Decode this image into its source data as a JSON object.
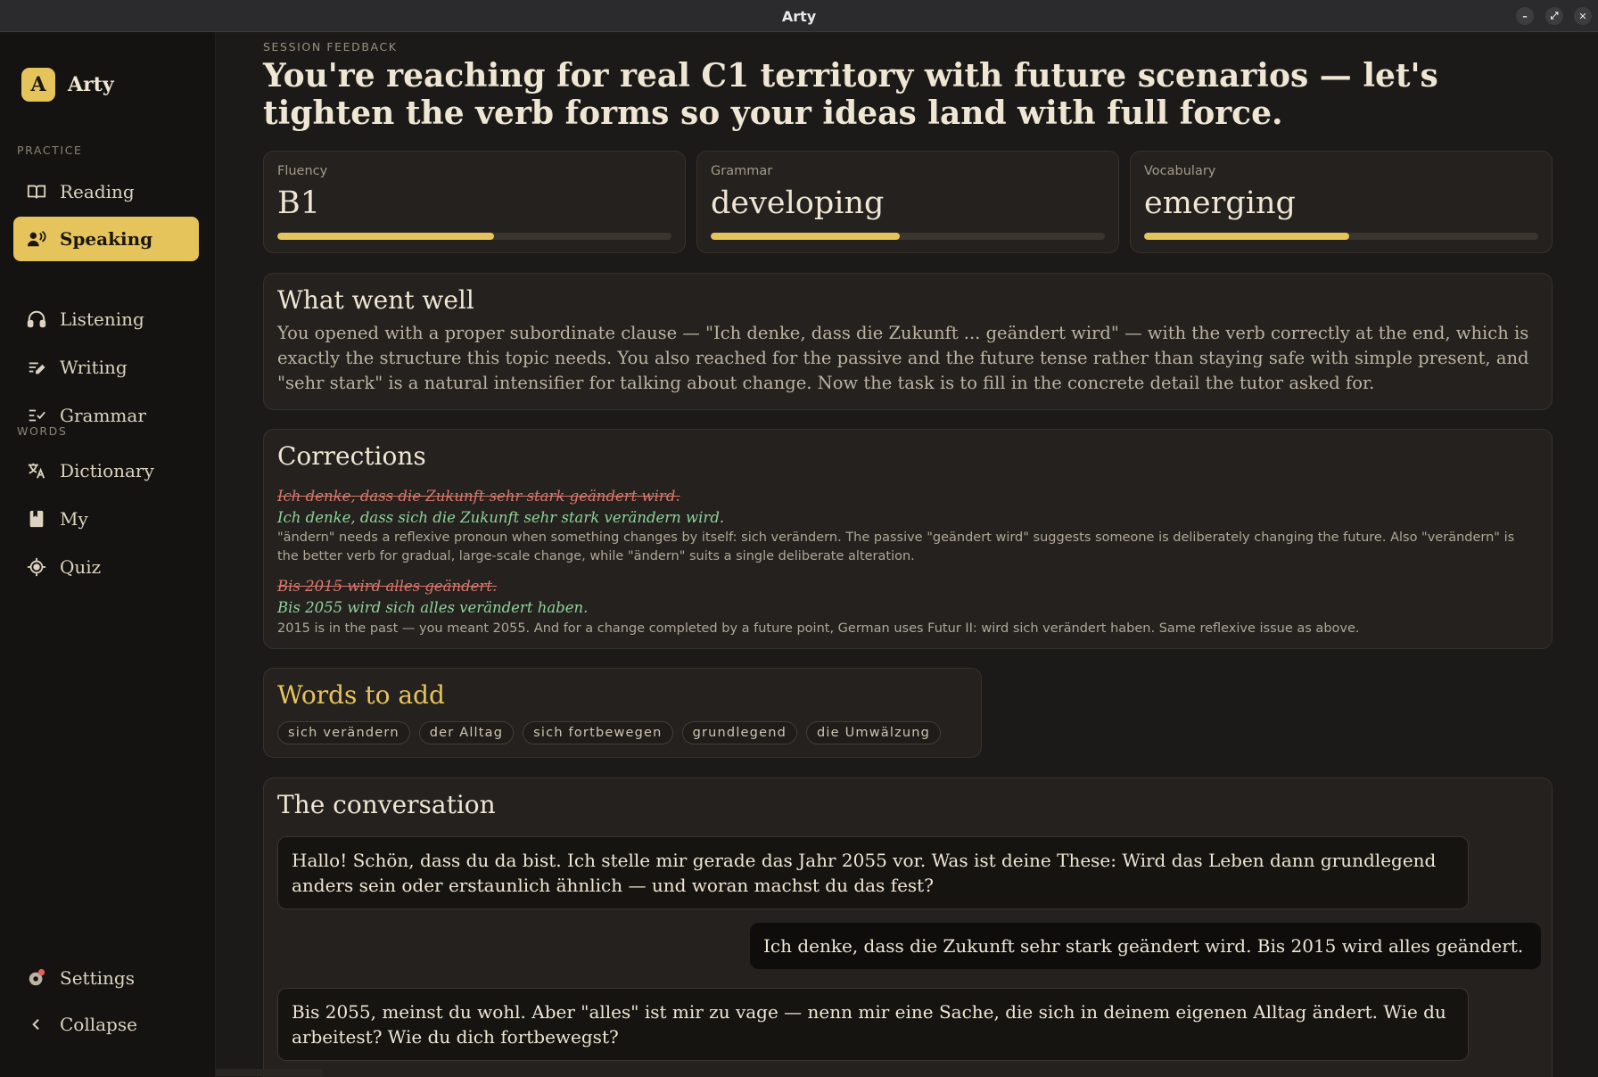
{
  "window": {
    "title": "Arty",
    "controls": {
      "minimize": "–",
      "maximize": "⤢",
      "close": "✕"
    }
  },
  "sidebar": {
    "brand_badge": "A",
    "brand_name": "Arty",
    "practice_label": "PRACTICE",
    "practice_items": [
      {
        "label": "Reading",
        "icon": "book-open-icon"
      },
      {
        "label": "Speaking",
        "icon": "speaking-person-icon",
        "active": true
      },
      {
        "label": "Listening",
        "icon": "headphones-icon"
      },
      {
        "label": "Writing",
        "icon": "pen-lines-icon"
      },
      {
        "label": "Grammar",
        "icon": "checklist-icon"
      }
    ],
    "words_label": "WORDS",
    "words_items": [
      {
        "label": "Dictionary",
        "icon": "translate-icon"
      },
      {
        "label": "My",
        "icon": "bookmark-book-icon"
      },
      {
        "label": "Quiz",
        "icon": "target-icon"
      }
    ],
    "settings_label": "Settings",
    "collapse_label": "Collapse"
  },
  "feedback": {
    "eyebrow": "SESSION FEEDBACK",
    "headline": "You're reaching for real C1 territory with future scenarios — let's tighten the verb forms so your ideas land with full force.",
    "metrics": [
      {
        "label": "Fluency",
        "value": "B1",
        "level": 0.55
      },
      {
        "label": "Grammar",
        "value": "developing",
        "level": 0.48
      },
      {
        "label": "Vocabulary",
        "value": "emerging",
        "level": 0.52
      }
    ],
    "went_well_title": "What went well",
    "went_well_text": "You opened with a proper subordinate clause — \"Ich denke, dass die Zukunft ... geändert wird\" — with the verb correctly at the end, which is exactly the structure this topic needs. You also reached for the passive and the future tense rather than staying safe with simple present, and \"sehr stark\" is a natural intensifier for talking about change. Now the task is to fill in the concrete detail the tutor asked for.",
    "corrections_title": "Corrections",
    "corrections": [
      {
        "wrong": "Ich denke, dass die Zukunft sehr stark geändert wird.",
        "right": "Ich denke, dass sich die Zukunft sehr stark verändern wird.",
        "explain": "\"ändern\" needs a reflexive pronoun when something changes by itself: sich verändern. The passive \"geändert wird\" suggests someone is deliberately changing the future. Also \"verändern\" is the better verb for gradual, large-scale change, while \"ändern\" suits a single deliberate alteration."
      },
      {
        "wrong": "Bis 2015 wird alles geändert.",
        "right": "Bis 2055 wird sich alles verändert haben.",
        "explain": "2015 is in the past — you meant 2055. And for a change completed by a future point, German uses Futur II: wird sich verändert haben. Same reflexive issue as above."
      }
    ],
    "words_title": "Words to add",
    "words": [
      "sich verändern",
      "der Alltag",
      "sich fortbewegen",
      "grundlegend",
      "die Umwälzung"
    ],
    "conversation_title": "The conversation",
    "messages": [
      {
        "role": "tutor",
        "text": "Hallo! Schön, dass du da bist. Ich stelle mir gerade das Jahr 2055 vor. Was ist deine These: Wird das Leben dann grundlegend anders sein oder erstaunlich ähnlich — und woran machst du das fest?"
      },
      {
        "role": "me",
        "text": "Ich denke, dass die Zukunft sehr stark geändert wird. Bis 2015 wird alles geändert."
      },
      {
        "role": "tutor",
        "text": "Bis 2055, meinst du wohl. Aber \"alles\" ist mir zu vage — nenn mir eine Sache, die sich in deinem eigenen Alltag ändert. Wie du arbeitest? Wie du dich fortbewegst?"
      }
    ]
  }
}
